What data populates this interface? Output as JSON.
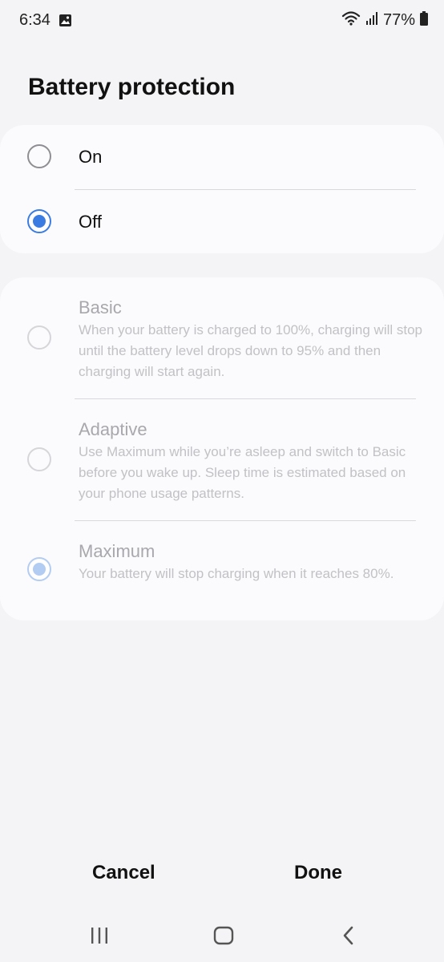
{
  "status_bar": {
    "time": "6:34",
    "battery_percent": "77%",
    "icons": [
      "gallery-icon",
      "wifi-icon",
      "signal-icon",
      "battery-icon"
    ]
  },
  "page": {
    "title": "Battery protection"
  },
  "toggle": {
    "options": [
      {
        "label": "On",
        "selected": false
      },
      {
        "label": "Off",
        "selected": true
      }
    ]
  },
  "modes": {
    "enabled": false,
    "items": [
      {
        "title": "Basic",
        "description": "When your battery is charged to 100%, charging will stop until the battery level drops down to 95% and then charging will start again.",
        "selected": false
      },
      {
        "title": "Adaptive",
        "description": "Use Maximum while you’re asleep and switch to Basic before you wake up. Sleep time is estimated based on your phone usage patterns.",
        "selected": false
      },
      {
        "title": "Maximum",
        "description": "Your battery will stop charging when it reaches 80%.",
        "selected": true
      }
    ]
  },
  "actions": {
    "cancel": "Cancel",
    "done": "Done"
  },
  "navbar": {
    "icons": [
      "recent-apps-icon",
      "home-icon",
      "back-icon"
    ]
  },
  "colors": {
    "accent": "#3a7ce2",
    "background": "#f4f4f6",
    "card": "#fbfbfd"
  }
}
